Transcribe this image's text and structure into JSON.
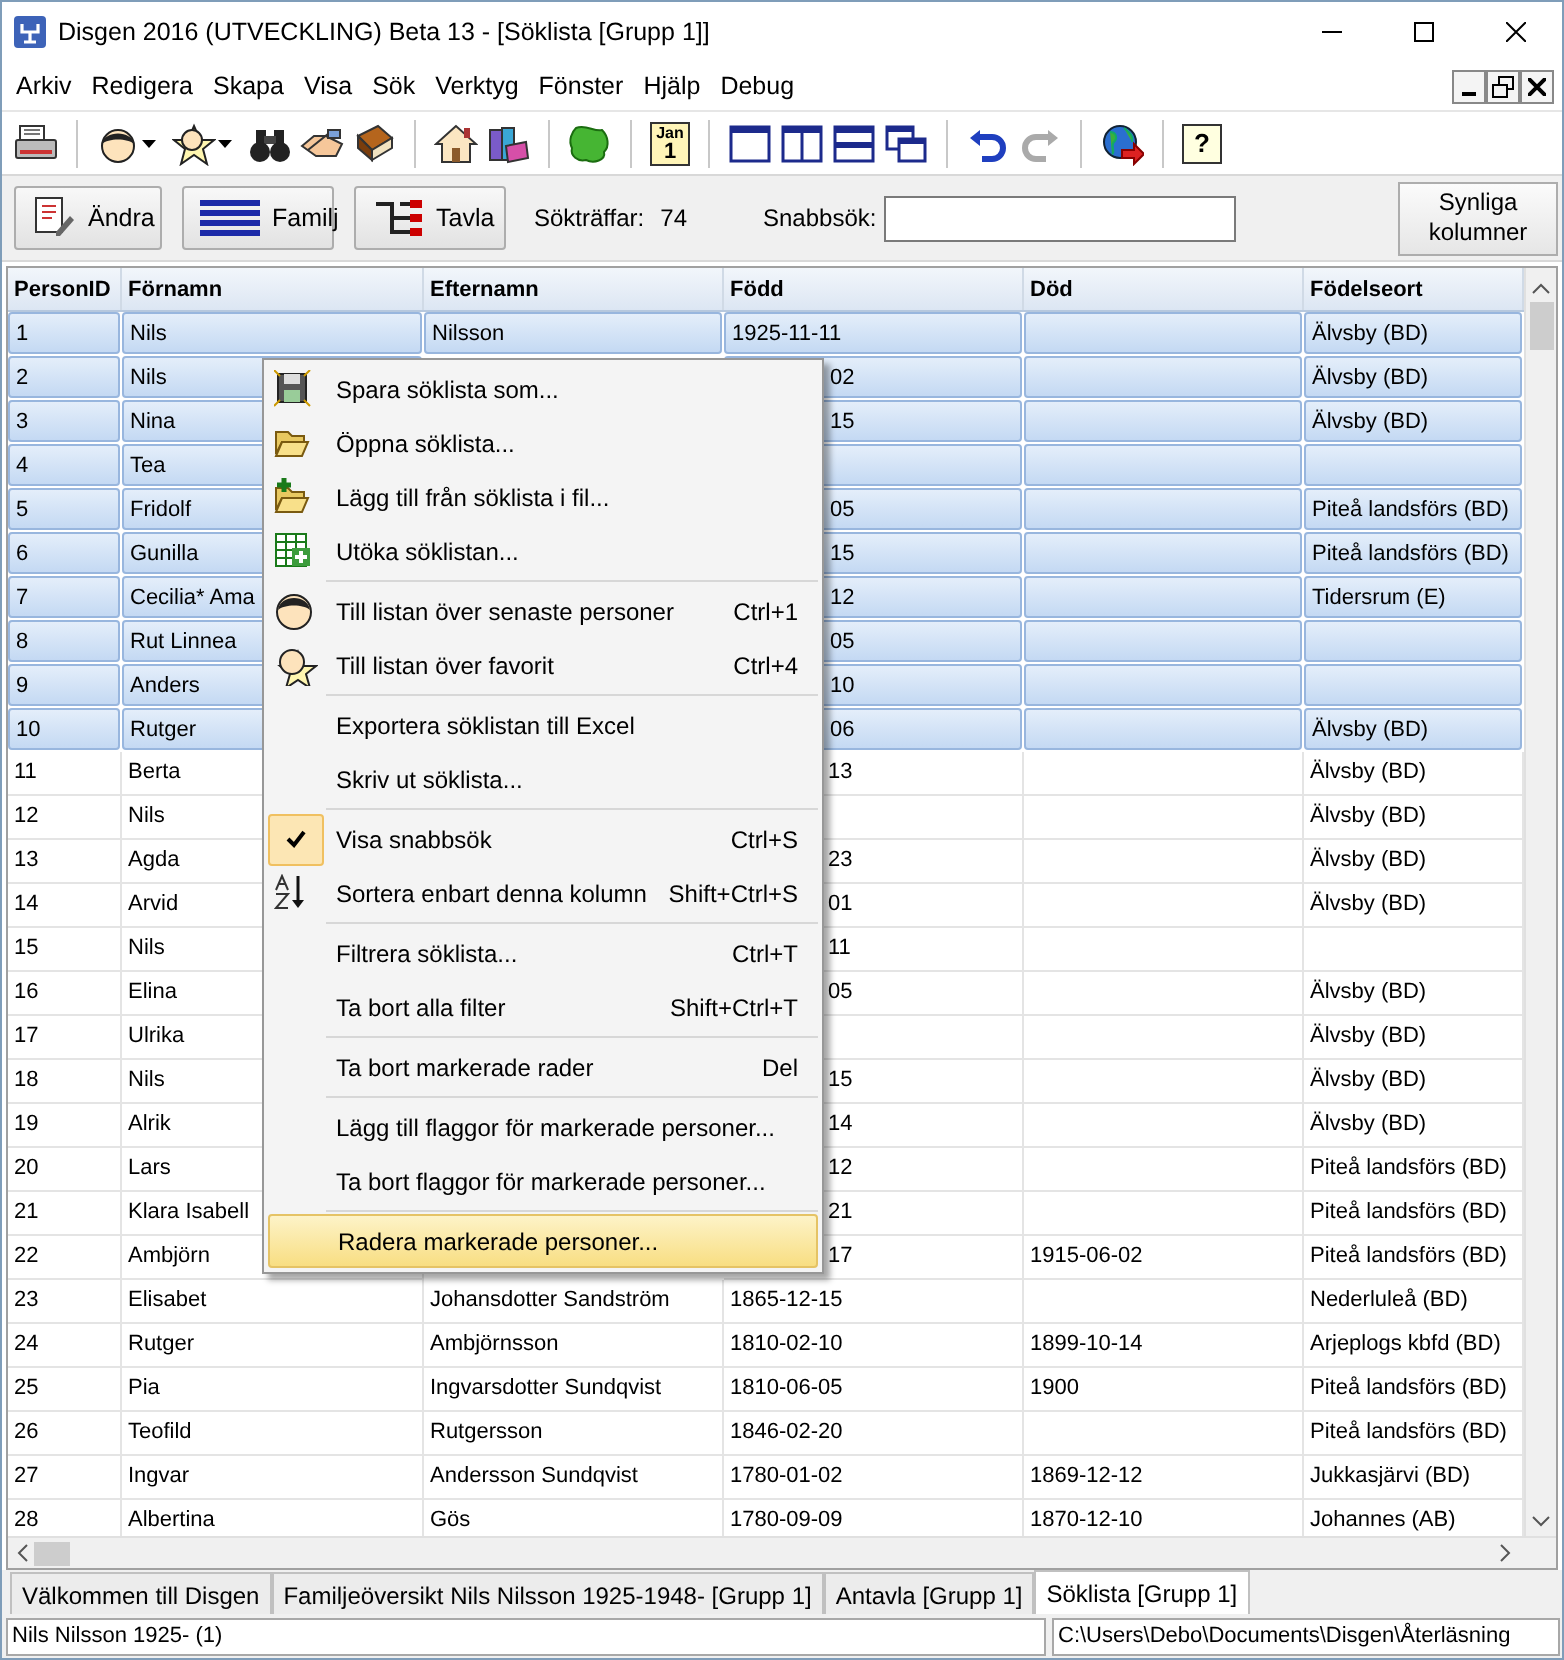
{
  "window": {
    "title": "Disgen 2016 (UTVECKLING) Beta 13 - [Söklista [Grupp 1]]"
  },
  "menubar": [
    "Arkiv",
    "Redigera",
    "Skapa",
    "Visa",
    "Sök",
    "Verktyg",
    "Fönster",
    "Hjälp",
    "Debug"
  ],
  "toolbar": {
    "groups": [
      [
        {
          "disabled": false,
          "dropdown": false
        }
      ],
      [
        {
          "disabled": false,
          "dropdown": true
        },
        {
          "disabled": false,
          "dropdown": true
        },
        {
          "disabled": false,
          "dropdown": false
        },
        {
          "disabled": false,
          "dropdown": false
        },
        {
          "disabled": false,
          "dropdown": false
        }
      ],
      [
        {
          "disabled": false,
          "dropdown": false
        },
        {
          "disabled": false,
          "dropdown": false
        }
      ],
      [
        {
          "disabled": false,
          "dropdown": false
        }
      ],
      [
        {
          "disabled": false,
          "dropdown": false,
          "month": "Jan",
          "day": "1"
        }
      ],
      [
        {
          "disabled": false,
          "dropdown": false
        },
        {
          "disabled": false,
          "dropdown": false
        },
        {
          "disabled": false,
          "dropdown": false
        },
        {
          "disabled": false,
          "dropdown": false
        }
      ],
      [
        {
          "disabled": false,
          "dropdown": false
        },
        {
          "disabled": true,
          "dropdown": false
        }
      ],
      [
        {
          "disabled": false,
          "dropdown": false
        }
      ],
      [
        {
          "disabled": false,
          "dropdown": false,
          "label": "?"
        }
      ]
    ]
  },
  "actions": {
    "buttons": [
      "Ändra",
      "Familj",
      "Tavla"
    ],
    "hits_label": "Sökträffar:",
    "hits": "74",
    "quicksearch_label": "Snabbsök:",
    "columns_button": "Synliga kolumner"
  },
  "table": {
    "columns": [
      "PersonID",
      "Förnamn",
      "Efternamn",
      "Född",
      "Död",
      "Födelseort"
    ],
    "rows": [
      {
        "selected": true,
        "covered": false,
        "id": "1",
        "first": "Nils",
        "last": "Nilsson",
        "born": "1925-11-11",
        "place": "Älvsby (BD)"
      },
      {
        "selected": true,
        "covered": true,
        "id": "2",
        "first": "Nils",
        "born": "02",
        "place": "Älvsby (BD)"
      },
      {
        "selected": true,
        "covered": true,
        "id": "3",
        "first": "Nina",
        "born": "15",
        "place": "Älvsby (BD)"
      },
      {
        "selected": true,
        "covered": true,
        "id": "4",
        "first": "Tea"
      },
      {
        "selected": true,
        "covered": true,
        "id": "5",
        "first": "Fridolf",
        "born": "05",
        "place": "Piteå landsförs (BD)"
      },
      {
        "selected": true,
        "covered": true,
        "id": "6",
        "first": "Gunilla",
        "born": "15",
        "place": "Piteå landsförs (BD)"
      },
      {
        "selected": true,
        "covered": true,
        "id": "7",
        "first": "Cecilia* Ama",
        "born": "12",
        "place": "Tidersrum (E)"
      },
      {
        "selected": true,
        "covered": true,
        "id": "8",
        "first": "Rut Linnea",
        "born": "05"
      },
      {
        "selected": true,
        "covered": true,
        "id": "9",
        "first": "Anders",
        "born": "10"
      },
      {
        "selected": true,
        "covered": true,
        "id": "10",
        "first": "Rutger",
        "born": "06",
        "place": "Älvsby (BD)"
      },
      {
        "selected": false,
        "covered": true,
        "id": "11",
        "first": "Berta",
        "born": "13",
        "place": "Älvsby (BD)"
      },
      {
        "selected": false,
        "covered": true,
        "id": "12",
        "first": "Nils",
        "place": "Älvsby (BD)"
      },
      {
        "selected": false,
        "covered": true,
        "id": "13",
        "first": "Agda",
        "born": "23",
        "place": "Älvsby (BD)"
      },
      {
        "selected": false,
        "covered": true,
        "id": "14",
        "first": "Arvid",
        "born": "01",
        "place": "Älvsby (BD)"
      },
      {
        "selected": false,
        "covered": true,
        "id": "15",
        "first": "Nils",
        "born": "11"
      },
      {
        "selected": false,
        "covered": true,
        "id": "16",
        "first": "Elina",
        "born": "05",
        "place": "Älvsby (BD)"
      },
      {
        "selected": false,
        "covered": true,
        "id": "17",
        "first": "Ulrika",
        "place": "Älvsby (BD)"
      },
      {
        "selected": false,
        "covered": true,
        "id": "18",
        "first": "Nils",
        "born": "15",
        "place": "Älvsby (BD)"
      },
      {
        "selected": false,
        "covered": true,
        "id": "19",
        "first": "Alrik",
        "born": "14",
        "place": "Älvsby (BD)"
      },
      {
        "selected": false,
        "covered": true,
        "id": "20",
        "first": "Lars",
        "born": "12",
        "place": "Piteå landsförs (BD)"
      },
      {
        "selected": false,
        "covered": true,
        "id": "21",
        "first": "Klara Isabell",
        "born": "21",
        "place": "Piteå landsförs (BD)"
      },
      {
        "selected": false,
        "covered": true,
        "id": "22",
        "first": "Ambjörn",
        "born": "17",
        "died": "1915-06-02",
        "place": "Piteå landsförs (BD)"
      },
      {
        "selected": false,
        "covered": false,
        "id": "23",
        "first": "Elisabet",
        "last": "Johansdotter Sandström",
        "born": "1865-12-15",
        "place": "Nederluleå (BD)"
      },
      {
        "selected": false,
        "covered": false,
        "id": "24",
        "first": "Rutger",
        "last": "Ambjörnsson",
        "born": "1810-02-10",
        "died": "1899-10-14",
        "place": "Arjeplogs kbfd (BD)"
      },
      {
        "selected": false,
        "covered": false,
        "id": "25",
        "first": "Pia",
        "last": "Ingvarsdotter Sundqvist",
        "born": "1810-06-05",
        "died": "1900",
        "place": "Piteå landsförs (BD)"
      },
      {
        "selected": false,
        "covered": false,
        "id": "26",
        "first": "Teofild",
        "last": "Rutgersson",
        "born": "1846-02-20",
        "place": "Piteå landsförs (BD)"
      },
      {
        "selected": false,
        "covered": false,
        "id": "27",
        "first": "Ingvar",
        "last": "Andersson Sundqvist",
        "born": "1780-01-02",
        "died": "1869-12-12",
        "place": "Jukkasjärvi (BD)"
      },
      {
        "selected": false,
        "covered": false,
        "id": "28",
        "first": "Albertina",
        "last": "Gös",
        "born": "1780-09-09",
        "died": "1870-12-10",
        "place": "Johannes (AB)"
      }
    ]
  },
  "context_menu": {
    "groups": [
      [
        {
          "label": "Spara söklista som...",
          "checked": false,
          "highlighted": false
        },
        {
          "label": "Öppna söklista...",
          "checked": false,
          "highlighted": false
        },
        {
          "label": "Lägg till från söklista i fil...",
          "checked": false,
          "highlighted": false
        },
        {
          "label": "Utöka söklistan...",
          "checked": false,
          "highlighted": false
        }
      ],
      [
        {
          "label": "Till listan över senaste personer",
          "shortcut": "Ctrl+1",
          "checked": false,
          "highlighted": false
        },
        {
          "label": "Till listan över favorit",
          "shortcut": "Ctrl+4",
          "checked": false,
          "highlighted": false
        }
      ],
      [
        {
          "label": "Exportera söklistan till Excel",
          "checked": false,
          "highlighted": false
        },
        {
          "label": "Skriv ut söklista...",
          "checked": false,
          "highlighted": false
        }
      ],
      [
        {
          "label": "Visa snabbsök",
          "shortcut": "Ctrl+S",
          "checked": true,
          "highlighted": false
        },
        {
          "label": "Sortera enbart denna kolumn",
          "shortcut": "Shift+Ctrl+S",
          "checked": false,
          "highlighted": false
        }
      ],
      [
        {
          "label": "Filtrera söklista...",
          "shortcut": "Ctrl+T",
          "checked": false,
          "highlighted": false
        },
        {
          "label": "Ta bort alla filter",
          "shortcut": "Shift+Ctrl+T",
          "checked": false,
          "highlighted": false
        }
      ],
      [
        {
          "label": "Ta bort markerade rader",
          "shortcut": "Del",
          "checked": false,
          "highlighted": false
        }
      ],
      [
        {
          "label": "Lägg till flaggor för markerade personer...",
          "checked": false,
          "highlighted": false
        },
        {
          "label": "Ta bort flaggor för markerade personer...",
          "checked": false,
          "highlighted": false
        }
      ],
      [
        {
          "label": "Radera markerade personer...",
          "checked": false,
          "highlighted": true
        }
      ]
    ]
  },
  "tabs": [
    {
      "label": "Välkommen till Disgen",
      "selected": false
    },
    {
      "label": "Familjeöversikt Nils Nilsson 1925-1948- [Grupp 1]",
      "selected": false
    },
    {
      "label": "Antavla [Grupp 1]",
      "selected": false
    },
    {
      "label": "Söklista [Grupp 1]",
      "selected": true
    }
  ],
  "status_bar": [
    "Nils Nilsson 1925- (1)",
    "C:\\Users\\Debo\\Documents\\Disgen\\Återläsning"
  ]
}
